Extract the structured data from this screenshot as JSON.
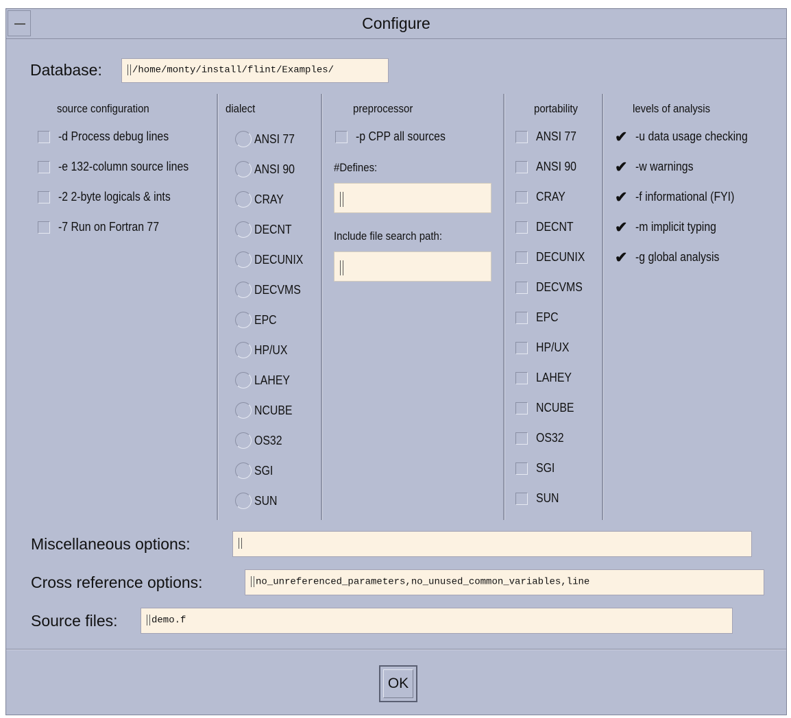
{
  "window": {
    "title": "Configure"
  },
  "database": {
    "label": "Database:",
    "value": "/home/monty/install/flint/Examples/"
  },
  "source_config": {
    "header": "source configuration",
    "items": [
      {
        "label": "-d  Process debug lines",
        "checked": false
      },
      {
        "label": "-e  132-column source lines",
        "checked": false
      },
      {
        "label": "-2  2-byte logicals & ints",
        "checked": false
      },
      {
        "label": "-7  Run on Fortran 77",
        "checked": false
      }
    ]
  },
  "dialect": {
    "header": "dialect",
    "options": [
      "ANSI 77",
      "ANSI 90",
      "CRAY",
      "DECNT",
      "DECUNIX",
      "DECVMS",
      "EPC",
      "HP/UX",
      "LAHEY",
      "NCUBE",
      "OS32",
      "SGI",
      "SUN"
    ]
  },
  "preprocessor": {
    "header": "preprocessor",
    "cpp_label": "-p  CPP all sources",
    "defines_label": "#Defines:",
    "defines_value": "",
    "include_label": "Include file search path:",
    "include_value": ""
  },
  "portability": {
    "header": "portability",
    "options": [
      "ANSI 77",
      "ANSI 90",
      "CRAY",
      "DECNT",
      "DECUNIX",
      "DECVMS",
      "EPC",
      "HP/UX",
      "LAHEY",
      "NCUBE",
      "OS32",
      "SGI",
      "SUN"
    ]
  },
  "analysis": {
    "header": "levels of analysis",
    "items": [
      {
        "label": "-u  data usage checking",
        "checked": true
      },
      {
        "label": "-w  warnings",
        "checked": true
      },
      {
        "label": "-f  informational (FYI)",
        "checked": true
      },
      {
        "label": "-m  implicit typing",
        "checked": true
      },
      {
        "label": "-g  global analysis",
        "checked": true
      }
    ]
  },
  "misc": {
    "label": "Miscellaneous options:",
    "value": ""
  },
  "xref": {
    "label": "Cross reference options:",
    "value": "no_unreferenced_parameters,no_unused_common_variables,line"
  },
  "source_files": {
    "label": "Source files:",
    "value": "demo.f"
  },
  "ok_label": "OK"
}
